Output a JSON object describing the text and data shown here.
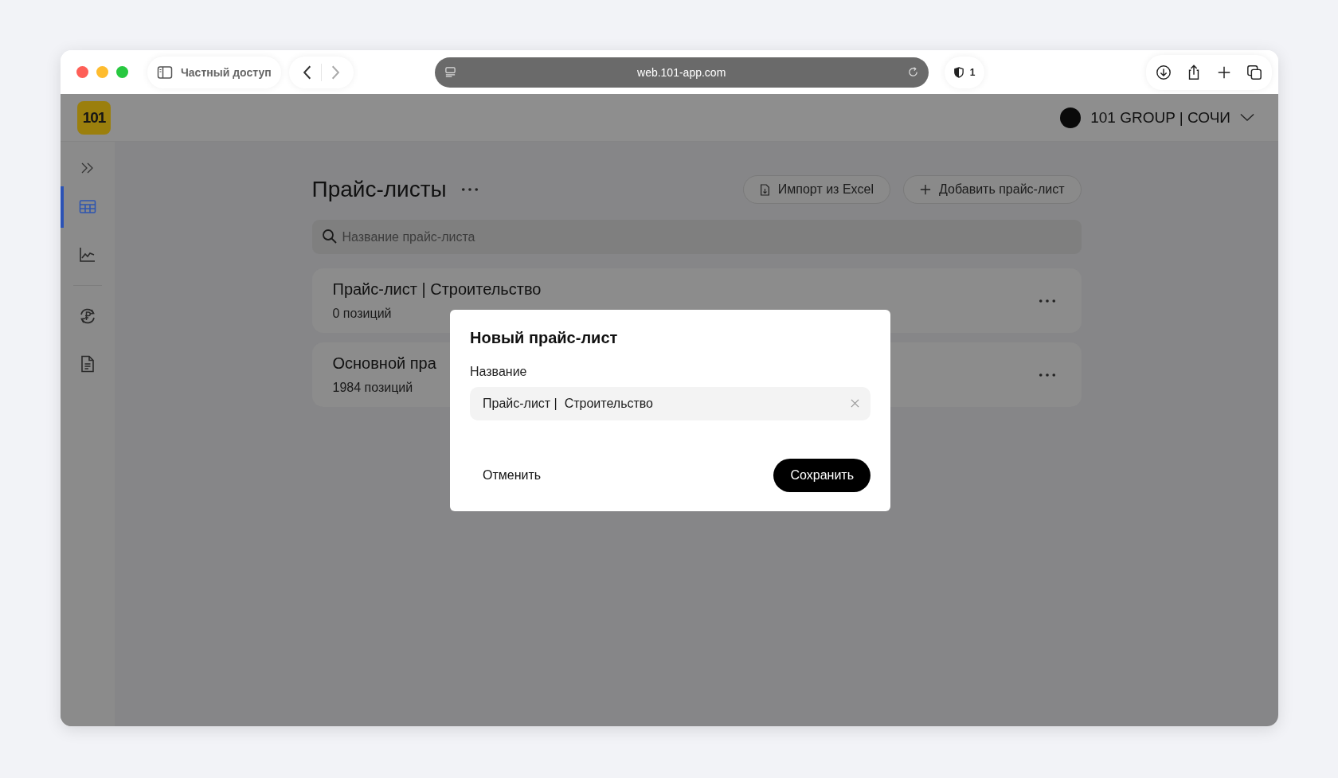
{
  "browser": {
    "private_label": "Частный доступ",
    "url": "web.101-app.com",
    "shield_count": "1"
  },
  "app": {
    "logo": "101",
    "org": "101 GROUP | СОЧИ"
  },
  "sidebar": {
    "items": [
      {
        "selected": true
      },
      {
        "selected": false
      },
      {
        "selected": false
      },
      {
        "selected": false
      }
    ]
  },
  "page": {
    "title": "Прайс-листы",
    "buttons": [
      "Импорт из Excel",
      "Добавить прайс-лист"
    ],
    "search": {
      "placeholder": "Название прайс-листа"
    },
    "price_lists": [
      {
        "name": "Прайс-лист | Строительство",
        "count": "0 позиций"
      },
      {
        "name": "Основной пра",
        "count": "1984 позиций"
      }
    ]
  },
  "dialog": {
    "title": "Новый прайс-лист",
    "field_label": "Название",
    "value": "Прайс-лист |  Строительство",
    "cancel": "Отменить",
    "save": "Сохранить"
  }
}
